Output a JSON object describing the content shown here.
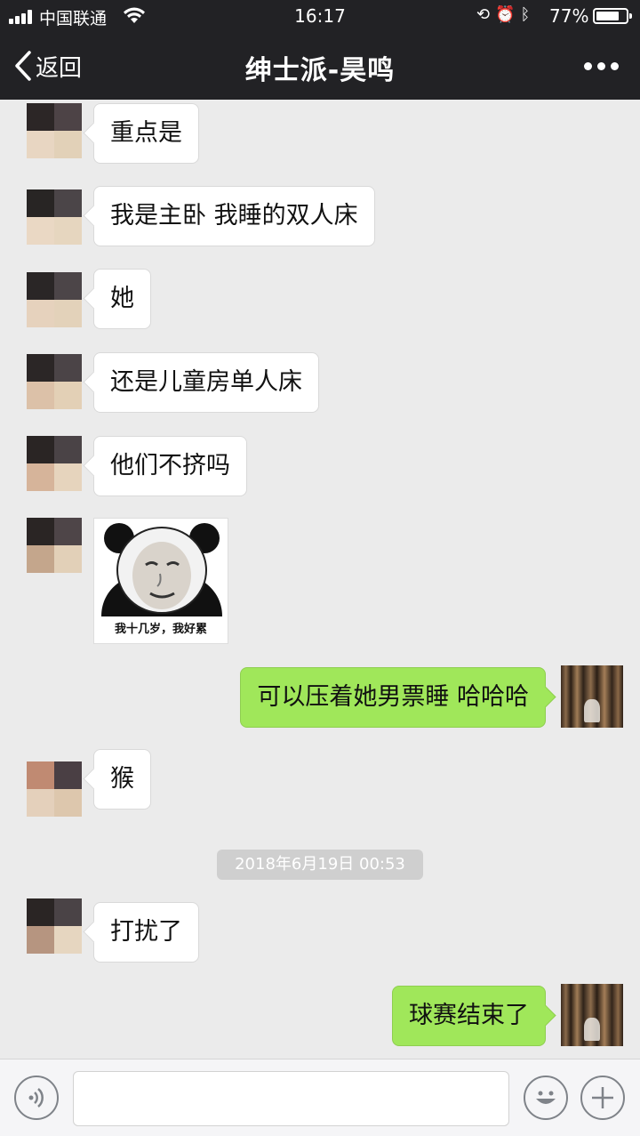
{
  "status_bar": {
    "carrier": "中国联通",
    "time": "16:17",
    "battery_percent": "77%",
    "battery_level": 0.77,
    "icons": [
      "signal-icon",
      "wifi-icon",
      "rotation-lock-icon",
      "alarm-icon",
      "bluetooth-icon",
      "battery-icon"
    ]
  },
  "nav": {
    "back_label": "返回",
    "title": "绅士派-昊鸣",
    "more_icon": "more-dots-icon"
  },
  "messages": [
    {
      "side": "in",
      "text": "重点是"
    },
    {
      "side": "in",
      "text": "我是主卧 我睡的双人床"
    },
    {
      "side": "in",
      "text": "她"
    },
    {
      "side": "in",
      "text": "还是儿童房单人床"
    },
    {
      "side": "in",
      "text": "他们不挤吗"
    },
    {
      "side": "in",
      "type": "sticker",
      "caption": "我十几岁，我好累"
    },
    {
      "side": "out",
      "text": "可以压着她男票睡 哈哈哈"
    },
    {
      "side": "in",
      "text": "猴"
    },
    {
      "type": "timestamp",
      "text": "2018年6月19日 00:53"
    },
    {
      "side": "in",
      "text": "打扰了"
    },
    {
      "side": "out",
      "text": "球赛结束了"
    }
  ],
  "input_bar": {
    "voice_icon": "voice-icon",
    "emoji_icon": "emoji-icon",
    "plus_icon": "plus-icon",
    "text_value": ""
  },
  "colors": {
    "nav_bg": "#222225",
    "chat_bg": "#ebebeb",
    "outgoing_bubble": "#a0e75a",
    "incoming_bubble": "#ffffff"
  }
}
